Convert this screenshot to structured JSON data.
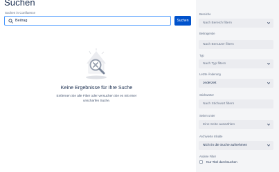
{
  "page": {
    "title": "Suchen"
  },
  "search": {
    "label": "Suchen in Confluence",
    "value": "Beitrag",
    "button_label": "Suchen"
  },
  "empty_state": {
    "title": "Keine Ergebnisse für Ihre Suche",
    "description": "Entfernen Sie alle Filter oder versuchen Sie es mit einer unscharfen Suche."
  },
  "filters": {
    "bereiche": {
      "label": "Bereiche",
      "placeholder": "Nach Bereich filtern"
    },
    "beitragende": {
      "label": "Beitragende",
      "placeholder": "Nach Benutzer filtern"
    },
    "typ": {
      "label": "Typ",
      "placeholder": "Nach Typ filtern"
    },
    "letzte_aenderung": {
      "label": "Letzte Änderung",
      "value": "Jederzeit"
    },
    "stichwoerter": {
      "label": "Stichwörter",
      "placeholder": "Nach Stichwort filtern"
    },
    "seiten_unter": {
      "label": "Seiten unter",
      "placeholder": "Eine Seite auswählen"
    },
    "archivierte_inhalte": {
      "label": "Archivierte Inhalte",
      "value": "Nicht in die Suche aufnehmen"
    },
    "andere_filter": {
      "label": "Andere Filter",
      "checkbox_label": "Nur Titel durchsuchen",
      "checked": false
    }
  },
  "colors": {
    "primary": "#0052cc",
    "focus": "#4c9aff",
    "panel_bg": "#f4f5f7",
    "field_bg": "#ebecf0"
  }
}
